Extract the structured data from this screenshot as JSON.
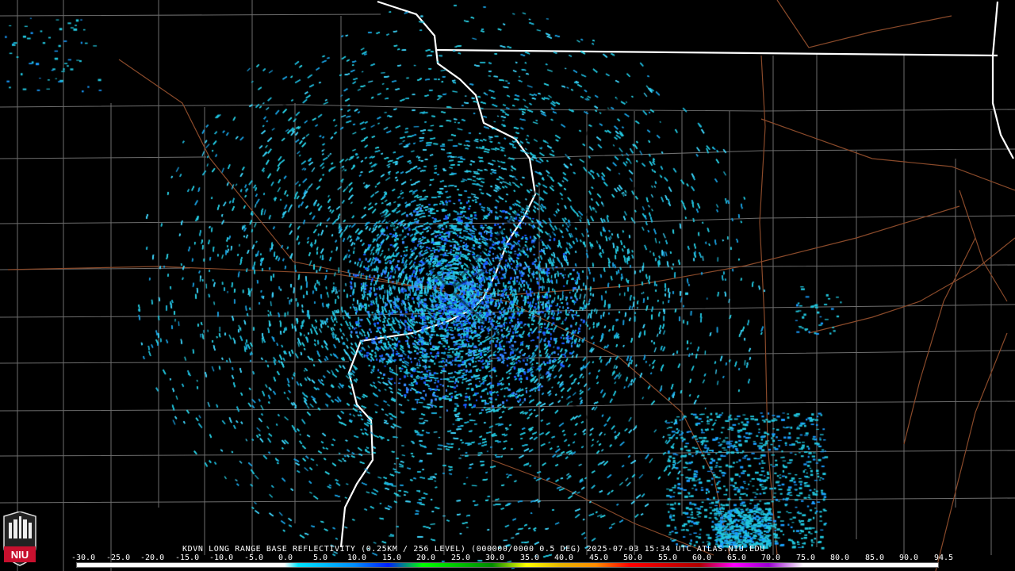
{
  "product": {
    "caption": "KDVN LONG RANGE BASE REFLECTIVITY (0.25KM / 256 LEVEL) (000000/0000 0.5 DEG) 2025-07-03 15:34 UTC  ATLAS.NIU.EDU"
  },
  "logo": {
    "text": "NIU"
  },
  "radar_site": {
    "id": "KDVN"
  },
  "colorscale": {
    "labels": [
      "-30.0",
      "-25.0",
      "-20.0",
      "-15.0",
      "-10.0",
      "-5.0",
      "0.0",
      "5.0",
      "10.0",
      "15.0",
      "20.0",
      "25.0",
      "30.0",
      "35.0",
      "40.0",
      "45.0",
      "50.0",
      "55.0",
      "60.0",
      "65.0",
      "70.0",
      "75.0",
      "80.0",
      "85.0",
      "90.0",
      "94.5"
    ],
    "stops": [
      {
        "value": -30,
        "color": "#ffffff"
      },
      {
        "value": 0,
        "color": "#ffffff"
      },
      {
        "value": 2,
        "color": "#00e5ff"
      },
      {
        "value": 10,
        "color": "#0090ff"
      },
      {
        "value": 15,
        "color": "#0020ff"
      },
      {
        "value": 20,
        "color": "#00ff00"
      },
      {
        "value": 30,
        "color": "#008a00"
      },
      {
        "value": 35,
        "color": "#ffff00"
      },
      {
        "value": 40,
        "color": "#e6b400"
      },
      {
        "value": 45,
        "color": "#ff8c00"
      },
      {
        "value": 50,
        "color": "#ff0000"
      },
      {
        "value": 60,
        "color": "#b00000"
      },
      {
        "value": 65,
        "color": "#ff00ff"
      },
      {
        "value": 70,
        "color": "#9a00d0"
      },
      {
        "value": 75,
        "color": "#ffffff"
      },
      {
        "value": 94.5,
        "color": "#ffffff"
      }
    ]
  },
  "colors": {
    "background": "#000000",
    "county_lines": "#6e6e6e",
    "state_lines": "#ffffff",
    "highways": "#8a4a2a",
    "echo_primary": "#22c8e0",
    "echo_core": "#1a5cff"
  }
}
